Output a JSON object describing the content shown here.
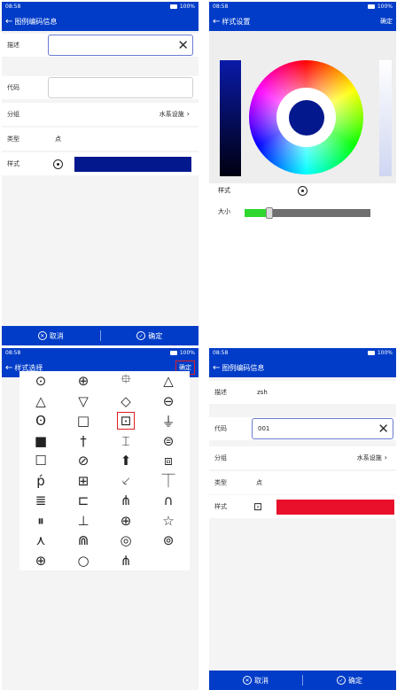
{
  "status": {
    "time": "08:58",
    "battery": "100%"
  },
  "panel1": {
    "title": "图例编码信息",
    "fields": {
      "desc_label": "描述",
      "code_label": "代码",
      "group_label": "分组",
      "group_value": "水系设施",
      "type_label": "类型",
      "type_value": "点",
      "style_label": "样式"
    },
    "style_color": "#04188e"
  },
  "panel2": {
    "title": "样式设置",
    "confirm": "确定",
    "style_label": "样式",
    "size_label": "大小",
    "selected_color": "#04188e",
    "size_level": 0.2
  },
  "panel3": {
    "title": "样式选择",
    "confirm": "确定",
    "symbols": [
      "⊙",
      "⊕",
      "⯐",
      "△",
      "△",
      "▽",
      "◇",
      "⊖",
      "ʘ",
      "□",
      "⊡",
      "⏚",
      "■",
      "†",
      "⌶",
      "⊜",
      "☐",
      "⊘",
      "⬆",
      "⧈",
      "ṕ",
      "⊞",
      "⸔",
      "⏉",
      "≣",
      "⊏",
      "⋔",
      "∩",
      "⏸",
      "⊥",
      "⊕",
      "☆",
      "⋏",
      "⋒",
      "◎",
      "⊚",
      "⊕",
      "○",
      "⋔"
    ],
    "selected_index": 10
  },
  "panel4": {
    "title": "图例编码信息",
    "fields": {
      "desc_label": "描述",
      "desc_value": "zsh",
      "code_label": "代码",
      "code_value": "001",
      "group_label": "分组",
      "group_value": "水系设施",
      "type_label": "类型",
      "type_value": "点",
      "style_label": "样式"
    },
    "style_color": "#e8102a"
  },
  "buttons": {
    "cancel": "取消",
    "confirm": "确定"
  }
}
